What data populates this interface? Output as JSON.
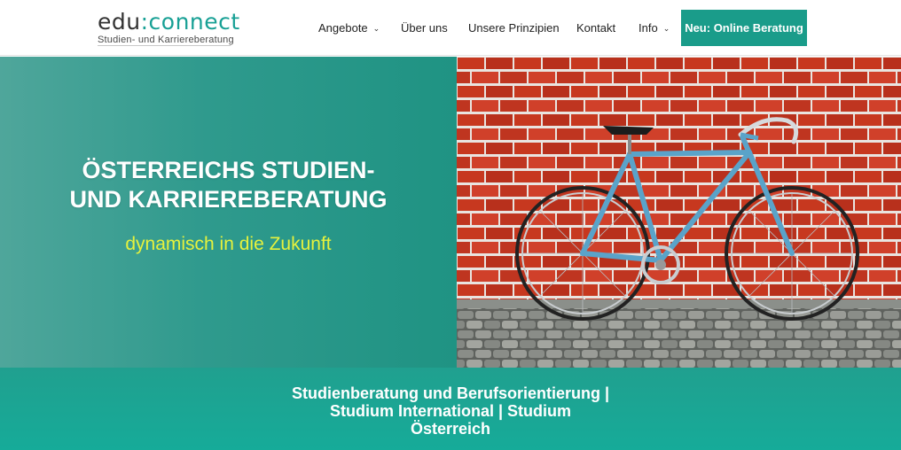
{
  "logo": {
    "part1": "edu",
    "colon": ":",
    "part2": "connect",
    "tagline": "Studien- und Karriereberatung"
  },
  "nav": {
    "items": [
      {
        "label": "Angebote",
        "has_dropdown": true
      },
      {
        "label": "Über uns",
        "has_dropdown": false
      },
      {
        "label": "Unsere Prinzipien",
        "has_dropdown": false
      },
      {
        "label": "Kontakt",
        "has_dropdown": false
      },
      {
        "label": "Info",
        "has_dropdown": true
      }
    ],
    "caret": "⌄",
    "cta_label": "Neu: Online Beratung"
  },
  "hero": {
    "title_line1": "ÖSTERREICHS STUDIEN-",
    "title_line2": "UND KARRIEREBERATUNG",
    "subtitle": "dynamisch in die Zukunft",
    "image_icon": "bicycle-against-brick-wall-photo"
  },
  "band": {
    "line1": "Studienberatung und Berufsorientierung |",
    "line2": "Studium International | Studium",
    "line3": "Österreich"
  },
  "colors": {
    "brand_teal": "#1a9c8a",
    "subtitle_yellow": "#e6f23d",
    "brick_red": "#c7381f"
  }
}
